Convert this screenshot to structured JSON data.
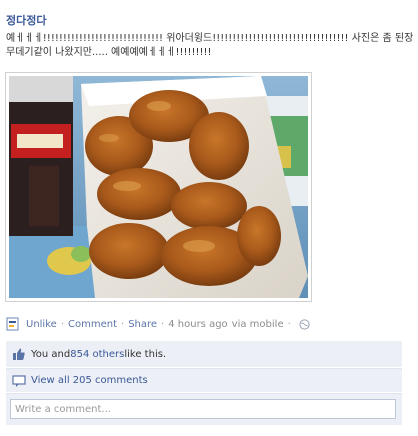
{
  "post": {
    "author": "정다정다",
    "message": "예ㅔㅔㅔ!!!!!!!!!!!!!!!!!!!!!!!!!!!!!! 위아더윙드!!!!!!!!!!!!!!!!!!!!!!!!!!!!!!!!!! 사진은 좀 된장무데기같이 나왔지만..... 예예예예ㅔㅔㅔ!!!!!!!!!",
    "photo_alt": "Fried chicken in a white box with a cup of cola"
  },
  "actions": {
    "unlike": "Unlike",
    "comment": "Comment",
    "share": "Share",
    "time": "4 hours ago",
    "via": "via mobile"
  },
  "likes": {
    "prefix": "You and ",
    "others": "854 others",
    "suffix": " like this."
  },
  "comments": {
    "view_all": "View all 205 comments"
  },
  "composer": {
    "placeholder": "Write a comment..."
  },
  "icons": {
    "page": "page-icon",
    "globe": "globe-icon",
    "like": "thumbs-up-icon",
    "comment": "comment-bubble-icon"
  },
  "colors": {
    "link": "#3b5998",
    "ufi_background": "#eceff5",
    "meta_text": "#8c8c8c"
  }
}
